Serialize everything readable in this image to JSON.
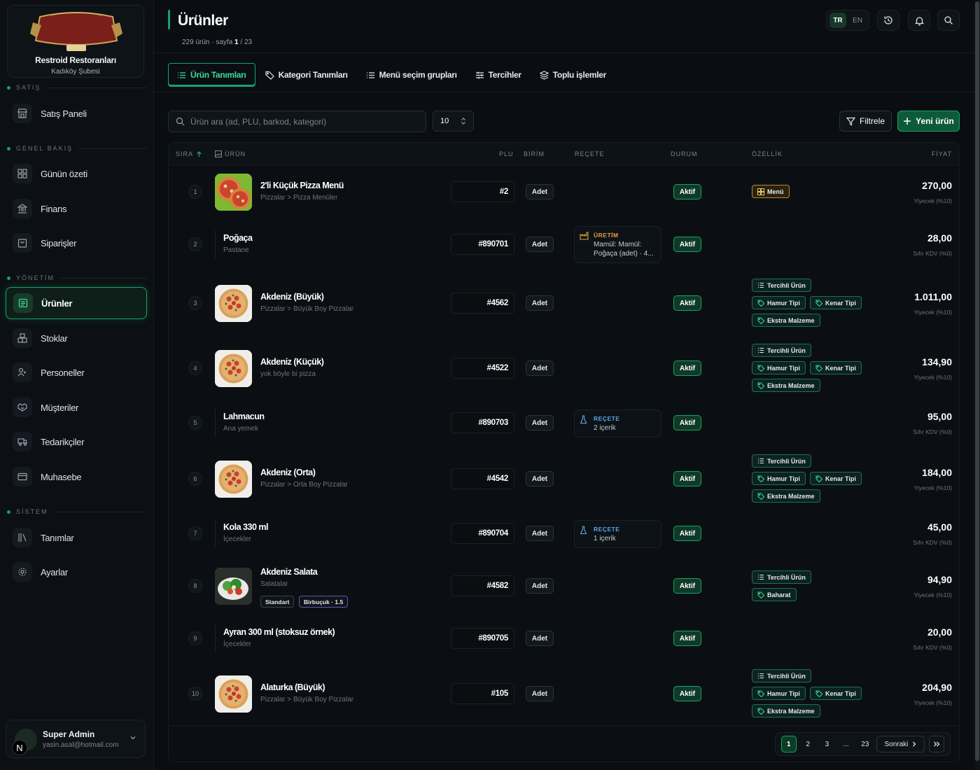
{
  "restaurant": {
    "name": "Restroid Restoranları",
    "branch": "Kadıköy Şubesi",
    "logo_top": "YEŞİLKÖYLÜ",
    "logo_main": "DÜRÜMCÜ BABA",
    "logo_year": "1989"
  },
  "sidebar": {
    "sections": [
      {
        "title": "SATIŞ",
        "items": [
          {
            "label": "Satış Paneli",
            "icon": "store-icon"
          }
        ]
      },
      {
        "title": "GENEL BAKIŞ",
        "items": [
          {
            "label": "Günün özeti",
            "icon": "grid-icon"
          },
          {
            "label": "Finans",
            "icon": "bank-icon"
          },
          {
            "label": "Siparişler",
            "icon": "bag-icon"
          }
        ]
      },
      {
        "title": "YÖNETİM",
        "items": [
          {
            "label": "Ürünler",
            "icon": "list-icon",
            "active": true
          },
          {
            "label": "Stoklar",
            "icon": "boxes-icon"
          },
          {
            "label": "Personeller",
            "icon": "users-icon"
          },
          {
            "label": "Müşteriler",
            "icon": "handshake-icon"
          },
          {
            "label": "Tedarikçiler",
            "icon": "truck-icon"
          },
          {
            "label": "Muhasebe",
            "icon": "card-icon"
          }
        ]
      },
      {
        "title": "SİSTEM",
        "items": [
          {
            "label": "Tanımlar",
            "icon": "library-icon"
          },
          {
            "label": "Ayarlar",
            "icon": "gear-icon"
          }
        ]
      }
    ]
  },
  "user": {
    "name": "Super Admin",
    "email": "yasin.asal@hotmail.com",
    "badge": "N"
  },
  "header": {
    "title": "Ürünler",
    "count_text": "229 ürün · sayfa",
    "page": "1",
    "pages": "/ 23",
    "lang": [
      "TR",
      "EN"
    ],
    "lang_active": "TR"
  },
  "tabs": [
    {
      "label": "Ürün Tanımları",
      "active": true
    },
    {
      "label": "Kategori Tanımları"
    },
    {
      "label": "Menü seçim grupları"
    },
    {
      "label": "Tercihler"
    },
    {
      "label": "Toplu işlemler"
    }
  ],
  "toolbar": {
    "search_placeholder": "Ürün ara (ad, PLU, barkod, kategori)",
    "page_size": "10",
    "filter_label": "Filtrele",
    "new_label": "Yeni ürün"
  },
  "columns": {
    "sira": "SIRA",
    "urun": "ÜRÜN",
    "plu": "PLU",
    "birim": "BİRİM",
    "recete": "REÇETE",
    "durum": "DURUM",
    "ozellik": "ÖZELLİK",
    "fiyat": "FİYAT"
  },
  "rows": [
    {
      "no": "1",
      "name": "2'li Küçük Pizza Menü",
      "sub": "Pizzalar > Pizza Menüler",
      "plu": "#2",
      "unit": "Adet",
      "status": "Aktif",
      "price": "270,00",
      "tax": "Yiyecek (%10)",
      "tags": [
        "Menü"
      ]
    },
    {
      "no": "2",
      "name": "Poğaça",
      "sub": "Pastane",
      "plu": "#890701",
      "unit": "Adet",
      "status": "Aktif",
      "price": "28,00",
      "tax": "Sıfır KDV (%0)",
      "recipe": {
        "type": "ÜRETİM",
        "l1": "Mamül: Mamül:",
        "l2": "Poğaça (adet) · 4..."
      }
    },
    {
      "no": "3",
      "name": "Akdeniz (Büyük)",
      "sub": "Pizzalar > Büyük Boy Pizzalar",
      "plu": "#4562",
      "unit": "Adet",
      "status": "Aktif",
      "price": "1.011,00",
      "tax": "Yiyecek (%10)",
      "tags": [
        "Tercihli Ürün",
        "Hamur Tipi",
        "Kenar Tipi",
        "Ekstra Malzeme"
      ]
    },
    {
      "no": "4",
      "name": "Akdeniz (Küçük)",
      "sub": "yok böyle bi pizza",
      "plu": "#4522",
      "unit": "Adet",
      "status": "Aktif",
      "price": "134,90",
      "tax": "Yiyecek (%10)",
      "tags": [
        "Tercihli Ürün",
        "Hamur Tipi",
        "Kenar Tipi",
        "Ekstra Malzeme"
      ]
    },
    {
      "no": "5",
      "name": "Lahmacun",
      "sub": "Ana yemek",
      "plu": "#890703",
      "unit": "Adet",
      "status": "Aktif",
      "price": "95,00",
      "tax": "Sıfır KDV (%0)",
      "recipe": {
        "type": "REÇETE",
        "l1": "2 içerik"
      }
    },
    {
      "no": "6",
      "name": "Akdeniz (Orta)",
      "sub": "Pizzalar > Orta Boy Pizzalar",
      "plu": "#4542",
      "unit": "Adet",
      "status": "Aktif",
      "price": "184,00",
      "tax": "Yiyecek (%10)",
      "tags": [
        "Tercihli Ürün",
        "Hamur Tipi",
        "Kenar Tipi",
        "Ekstra Malzeme"
      ]
    },
    {
      "no": "7",
      "name": "Kola 330 ml",
      "sub": "İçecekler",
      "plu": "#890704",
      "unit": "Adet",
      "status": "Aktif",
      "price": "45,00",
      "tax": "Sıfır KDV (%0)",
      "recipe": {
        "type": "REÇETE",
        "l1": "1 içerik"
      }
    },
    {
      "no": "8",
      "name": "Akdeniz Salata",
      "sub": "Salatalar",
      "plu": "#4582",
      "unit": "Adet",
      "status": "Aktif",
      "price": "94,90",
      "tax": "Yiyecek (%10)",
      "tags": [
        "Tercihli Ürün",
        "Baharat"
      ],
      "chips": [
        "Standart",
        "Birbuçuk · 1.5"
      ]
    },
    {
      "no": "9",
      "name": "Ayran 300 ml (stoksuz örnek)",
      "sub": "İçecekler",
      "plu": "#890705",
      "unit": "Adet",
      "status": "Aktif",
      "price": "20,00",
      "tax": "Sıfır KDV (%0)"
    },
    {
      "no": "10",
      "name": "Alaturka (Büyük)",
      "sub": "Pizzalar > Büyük Boy Pizzalar",
      "plu": "#105",
      "unit": "Adet",
      "status": "Aktif",
      "price": "204,90",
      "tax": "Yiyecek (%10)",
      "tags": [
        "Tercihli Ürün",
        "Hamur Tipi",
        "Kenar Tipi",
        "Ekstra Malzeme"
      ]
    }
  ],
  "pagination": {
    "pages": [
      "1",
      "2",
      "3",
      "...",
      "23"
    ],
    "current": "1",
    "next": "Sonraki"
  },
  "colors": {
    "accent": "#16a36a",
    "bg": "#0a0d11",
    "recipe_production": "#e8a13c",
    "recipe": "#5aa7f0"
  }
}
